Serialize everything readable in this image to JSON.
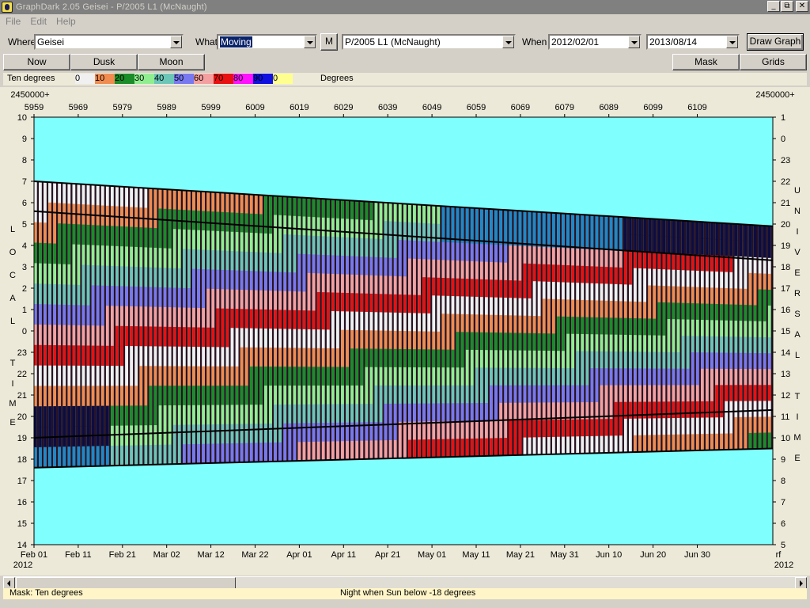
{
  "window": {
    "title": "GraphDark 2.05  Geisei  -  P/2005 L1 (McNaught)",
    "buttons": [
      "_",
      "⧉",
      "✕"
    ]
  },
  "menu": [
    "File",
    "Edit",
    "Help"
  ],
  "toolbar": {
    "where_label": "Where",
    "where_value": "Geisei",
    "what_label": "What",
    "what_value": "Moving",
    "m_button": "M",
    "object_value": "P/2005 L1 (McNaught)",
    "when_label": "When",
    "when_start": "2012/02/01",
    "when_end": "2013/08/14",
    "draw_button": "Draw Graph"
  },
  "buttons": {
    "now": "Now",
    "dusk": "Dusk",
    "moon": "Moon",
    "mask": "Mask",
    "grids": "Grids"
  },
  "legend": {
    "title": "Ten degrees",
    "unit": "Degrees",
    "items": [
      {
        "label": "0",
        "color": "#f0f0f0"
      },
      {
        "label": "10",
        "color": "#f08c50"
      },
      {
        "label": "20",
        "color": "#1a8c28"
      },
      {
        "label": "30",
        "color": "#90ee90"
      },
      {
        "label": "40",
        "color": "#6cc6b8"
      },
      {
        "label": "50",
        "color": "#7878f0"
      },
      {
        "label": "60",
        "color": "#f4a0a0"
      },
      {
        "label": "70",
        "color": "#e81010"
      },
      {
        "label": "80",
        "color": "#ff10ff"
      },
      {
        "label": "90",
        "color": "#1010e0"
      },
      {
        "label": "0",
        "color": "#ffff90"
      }
    ]
  },
  "chart_data": {
    "type": "heatmap",
    "jd_prefix_left": "2450000+",
    "jd_prefix_right": "2450000+",
    "jd_ticks": [
      "5959",
      "5969",
      "5979",
      "5989",
      "5999",
      "6009",
      "6019",
      "6029",
      "6039",
      "6049",
      "6059",
      "6069",
      "6079",
      "6089",
      "6099",
      "6109"
    ],
    "date_ticks": [
      "Feb 01",
      "Feb 11",
      "Feb 21",
      "Mar 02",
      "Mar 12",
      "Mar 22",
      "Apr 01",
      "Apr 11",
      "Apr 21",
      "May 01",
      "May 11",
      "May 21",
      "May 31",
      "Jun 10",
      "Jun 20",
      "Jun 30"
    ],
    "year_left": "2012",
    "year_right": "2012",
    "right_corner_label": "rf",
    "local_time_ticks": [
      "10",
      "9",
      "8",
      "7",
      "6",
      "5",
      "4",
      "3",
      "2",
      "1",
      "0",
      "23",
      "22",
      "21",
      "20",
      "19",
      "18",
      "17",
      "16",
      "15",
      "14"
    ],
    "universal_time_ticks": [
      "1",
      "0",
      "23",
      "22",
      "21",
      "20",
      "19",
      "18",
      "17",
      "16",
      "15",
      "14",
      "13",
      "12",
      "11",
      "10",
      "9",
      "8",
      "7",
      "6",
      "5"
    ],
    "left_axis_label": "LOCAL TIME",
    "right_axis_label": "UNIVERSAL TIME",
    "background_color": "#80ffff",
    "dusk_start": [
      17.6,
      18.5
    ],
    "dawn_end": [
      7.0,
      4.9
    ],
    "moon_set": [
      19.0,
      20.3
    ],
    "moon_rise": [
      5.6,
      3.3
    ]
  },
  "status": {
    "left": "Mask:  Ten degrees",
    "center": "Night when Sun below -18 degrees"
  }
}
